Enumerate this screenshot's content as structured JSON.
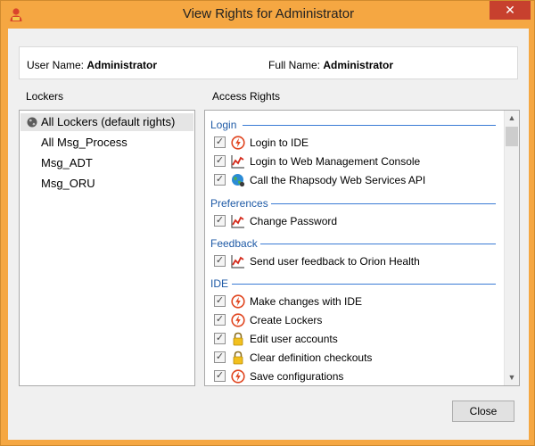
{
  "window": {
    "title": "View Rights for Administrator",
    "close_glyph": "✕",
    "app_icon": "user-icon"
  },
  "user_info": {
    "user_name_label": "User Name:",
    "user_name_value": "Administrator",
    "full_name_label": "Full Name:",
    "full_name_value": "Administrator"
  },
  "lockers": {
    "label": "Lockers",
    "items": [
      {
        "label": "All Lockers (default rights)",
        "selected": true,
        "icon": "globe-icon"
      },
      {
        "label": "All Msg_Process",
        "selected": false
      },
      {
        "label": "Msg_ADT",
        "selected": false
      },
      {
        "label": "Msg_ORU",
        "selected": false
      }
    ]
  },
  "access_rights": {
    "label": "Access Rights",
    "groups": [
      {
        "name": "Login",
        "rights": [
          {
            "label": "Login to IDE",
            "checked": true,
            "icon": "lightning-icon"
          },
          {
            "label": "Login to Web Management Console",
            "checked": true,
            "icon": "chart-icon"
          },
          {
            "label": "Call the Rhapsody Web Services API",
            "checked": true,
            "icon": "web-globe-icon"
          }
        ]
      },
      {
        "name": "Preferences",
        "rights": [
          {
            "label": "Change Password",
            "checked": true,
            "icon": "chart-icon"
          }
        ]
      },
      {
        "name": "Feedback",
        "rights": [
          {
            "label": "Send user feedback to Orion Health",
            "checked": true,
            "icon": "chart-icon"
          }
        ]
      },
      {
        "name": "IDE",
        "rights": [
          {
            "label": "Make changes with IDE",
            "checked": true,
            "icon": "lightning-icon"
          },
          {
            "label": "Create Lockers",
            "checked": true,
            "icon": "lightning-icon"
          },
          {
            "label": "Edit user accounts",
            "checked": true,
            "icon": "lock-icon"
          },
          {
            "label": "Clear definition checkouts",
            "checked": true,
            "icon": "lock-icon"
          },
          {
            "label": "Save configurations",
            "checked": true,
            "icon": "lightning-icon"
          }
        ]
      }
    ]
  },
  "buttons": {
    "close_label": "Close"
  },
  "colors": {
    "titlebar": "#f5a742",
    "close_button_bg": "#c7402e",
    "group_heading": "#1e5aa6",
    "selected_row": "#e5e5e5"
  }
}
